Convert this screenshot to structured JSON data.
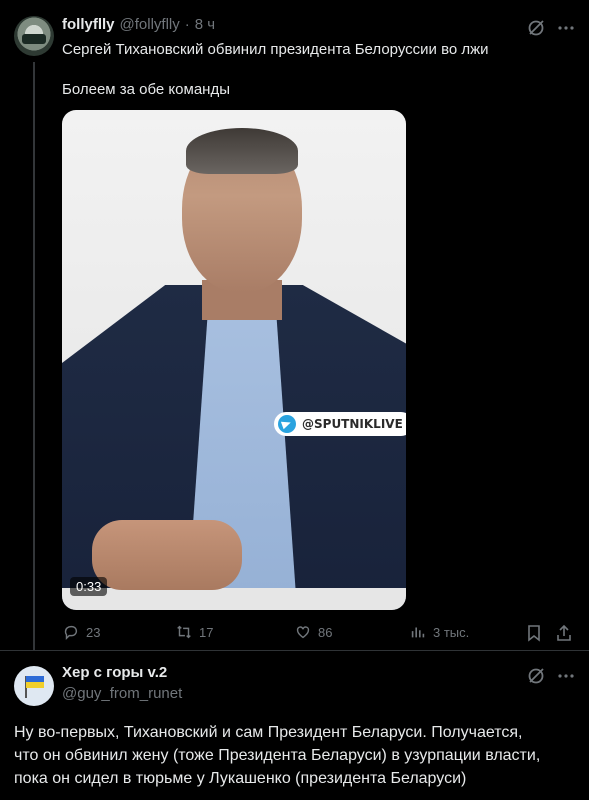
{
  "tweet": {
    "author_name": "follyflly",
    "author_handle": "@follyflly",
    "separator": "·",
    "time": "8 ч",
    "text_line1": "Сергей Тихановский обвинил президента Белоруссии во лжи",
    "text_line2": "Болеем за обе команды",
    "video": {
      "watermark": "@SPUTNIKLIVE",
      "duration": "0:33"
    },
    "actions": {
      "replies": "23",
      "retweets": "17",
      "likes": "86",
      "views": "3 тыс."
    }
  },
  "reply": {
    "author_name": "Хер с горы v.2",
    "author_handle": "@guy_from_runet",
    "text_line1": "Ну во-первых, Тихановский и сам Президент Беларуси. Получается,",
    "text_line2": "что он обвинил жену (тоже Президента Беларуси) в узурпации власти,",
    "text_line3": "пока он сидел в тюрьме у Лукашенко (президента Беларуси)"
  },
  "icons": {
    "grok": "grok-icon",
    "more": "more-icon",
    "reply": "reply-icon",
    "retweet": "retweet-icon",
    "like": "like-icon",
    "views": "views-icon",
    "bookmark": "bookmark-icon",
    "share": "share-icon"
  },
  "colors": {
    "background": "#000000",
    "text": "#e7e9ea",
    "muted": "#71767b",
    "divider": "#2f3336"
  }
}
